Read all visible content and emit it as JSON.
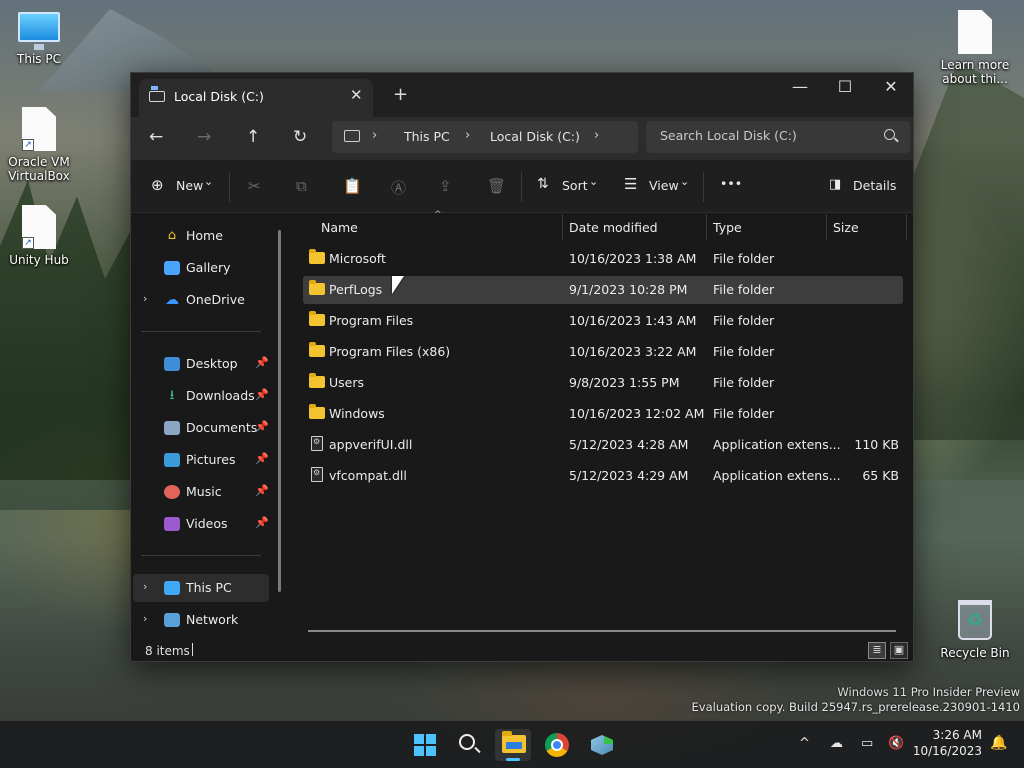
{
  "desktop": {
    "icons": [
      {
        "label": "This PC"
      },
      {
        "label": "Oracle VM VirtualBox"
      },
      {
        "label": "Unity Hub"
      },
      {
        "label": "Learn more about thi..."
      },
      {
        "label": "Recycle Bin"
      }
    ],
    "watermark_line1": "Windows 11 Pro Insider Preview",
    "watermark_line2": "Evaluation copy. Build 25947.rs_prerelease.230901-1410"
  },
  "window": {
    "tab_title": "Local Disk (C:)",
    "tab_close": "✕",
    "new_tab": "+",
    "minimize": "—",
    "maximize": "☐",
    "close": "✕",
    "nav": {
      "back": "←",
      "forward": "→",
      "up": "↑",
      "refresh": "↻"
    },
    "breadcrumb": [
      "This PC",
      "Local Disk (C:)"
    ],
    "chevron": "›",
    "search_placeholder": "Search Local Disk (C:)",
    "toolbar": {
      "new_label": "New",
      "sort_label": "Sort",
      "view_label": "View",
      "more_label": "•••",
      "details_label": "Details",
      "dropdown_glyph": "⌄"
    },
    "sidebar": {
      "items": [
        {
          "label": "Home",
          "expandable": false
        },
        {
          "label": "Gallery",
          "expandable": false
        },
        {
          "label": "OneDrive",
          "expandable": true
        }
      ],
      "pinned": [
        {
          "label": "Desktop"
        },
        {
          "label": "Downloads"
        },
        {
          "label": "Documents"
        },
        {
          "label": "Pictures"
        },
        {
          "label": "Music"
        },
        {
          "label": "Videos"
        }
      ],
      "drives": [
        {
          "label": "This PC",
          "selected": true
        },
        {
          "label": "Network"
        }
      ],
      "expand_glyph": "›",
      "pin_glyph": "📌"
    },
    "columns": {
      "name": "Name",
      "date": "Date modified",
      "type": "Type",
      "size": "Size",
      "sort_glyph": "^"
    },
    "files": [
      {
        "name": "Microsoft",
        "date": "10/16/2023 1:38 AM",
        "type": "File folder",
        "size": "",
        "kind": "folder"
      },
      {
        "name": "PerfLogs",
        "date": "9/1/2023 10:28 PM",
        "type": "File folder",
        "size": "",
        "kind": "folder"
      },
      {
        "name": "Program Files",
        "date": "10/16/2023 1:43 AM",
        "type": "File folder",
        "size": "",
        "kind": "folder"
      },
      {
        "name": "Program Files (x86)",
        "date": "10/16/2023 3:22 AM",
        "type": "File folder",
        "size": "",
        "kind": "folder"
      },
      {
        "name": "Users",
        "date": "9/8/2023 1:55 PM",
        "type": "File folder",
        "size": "",
        "kind": "folder"
      },
      {
        "name": "Windows",
        "date": "10/16/2023 12:02 AM",
        "type": "File folder",
        "size": "",
        "kind": "folder"
      },
      {
        "name": "appverifUI.dll",
        "date": "5/12/2023 4:28 AM",
        "type": "Application extens...",
        "size": "110 KB",
        "kind": "file"
      },
      {
        "name": "vfcompat.dll",
        "date": "5/12/2023 4:29 AM",
        "type": "Application extens...",
        "size": "65 KB",
        "kind": "file"
      }
    ],
    "status": {
      "item_count": "8 items"
    }
  },
  "taskbar": {
    "clock_time": "3:26 AM",
    "clock_date": "10/16/2023",
    "tray_chevron": "^"
  },
  "colors": {
    "accent": "#4cc2ff",
    "folder": "#f4c430",
    "window_bg": "#191919"
  }
}
